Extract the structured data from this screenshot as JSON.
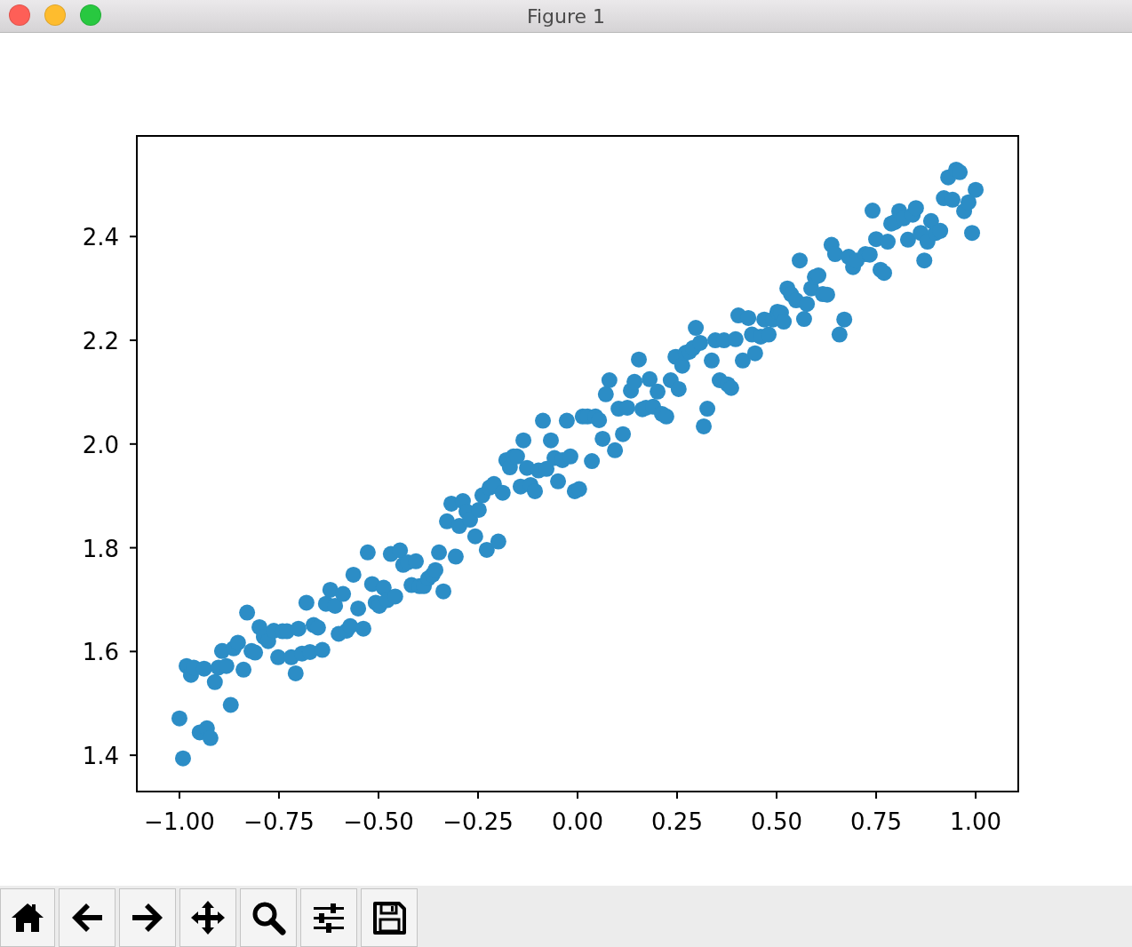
{
  "window": {
    "title": "Figure 1",
    "controls": [
      {
        "kind": "close"
      },
      {
        "kind": "minimize"
      },
      {
        "kind": "zoom"
      }
    ]
  },
  "chart_data": {
    "type": "scatter",
    "xlim": [
      -1.107,
      1.107
    ],
    "ylim": [
      1.33,
      2.594
    ],
    "xticks": [
      {
        "value": -1,
        "label": "−1.00"
      },
      {
        "value": -0.75,
        "label": "−0.75"
      },
      {
        "value": -0.5,
        "label": "−0.50"
      },
      {
        "value": -0.25,
        "label": "−0.25"
      },
      {
        "value": 0,
        "label": "0.00"
      },
      {
        "value": 0.25,
        "label": "0.25"
      },
      {
        "value": 0.5,
        "label": "0.50"
      },
      {
        "value": 0.75,
        "label": "0.75"
      },
      {
        "value": 1,
        "label": "1.00"
      }
    ],
    "yticks": [
      {
        "value": 1.4,
        "label": "1.4"
      },
      {
        "value": 1.6,
        "label": "1.6"
      },
      {
        "value": 1.8,
        "label": "1.8"
      },
      {
        "value": 2.0,
        "label": "2.0"
      },
      {
        "value": 2.2,
        "label": "2.2"
      },
      {
        "value": 2.4,
        "label": "2.4"
      }
    ],
    "x": [
      -1.0,
      -0.991,
      -0.982,
      -0.971,
      -0.964,
      -0.949,
      -0.938,
      -0.931,
      -0.922,
      -0.911,
      -0.902,
      -0.893,
      -0.882,
      -0.871,
      -0.864,
      -0.853,
      -0.839,
      -0.83,
      -0.819,
      -0.81,
      -0.799,
      -0.788,
      -0.777,
      -0.763,
      -0.752,
      -0.741,
      -0.73,
      -0.719,
      -0.708,
      -0.701,
      -0.692,
      -0.681,
      -0.672,
      -0.663,
      -0.652,
      -0.641,
      -0.632,
      -0.621,
      -0.609,
      -0.6,
      -0.589,
      -0.58,
      -0.571,
      -0.563,
      -0.551,
      -0.538,
      -0.527,
      -0.516,
      -0.507,
      -0.498,
      -0.487,
      -0.478,
      -0.469,
      -0.458,
      -0.446,
      -0.438,
      -0.426,
      -0.417,
      -0.406,
      -0.397,
      -0.386,
      -0.375,
      -0.364,
      -0.357,
      -0.348,
      -0.337,
      -0.328,
      -0.317,
      -0.306,
      -0.297,
      -0.288,
      -0.279,
      -0.27,
      -0.257,
      -0.248,
      -0.239,
      -0.228,
      -0.221,
      -0.21,
      -0.199,
      -0.188,
      -0.179,
      -0.17,
      -0.161,
      -0.152,
      -0.143,
      -0.136,
      -0.127,
      -0.118,
      -0.107,
      -0.098,
      -0.087,
      -0.078,
      -0.067,
      -0.058,
      -0.049,
      -0.038,
      -0.027,
      -0.018,
      -0.007,
      0.004,
      0.013,
      0.025,
      0.036,
      0.045,
      0.054,
      0.063,
      0.071,
      0.08,
      0.094,
      0.103,
      0.114,
      0.125,
      0.134,
      0.143,
      0.154,
      0.163,
      0.172,
      0.181,
      0.19,
      0.201,
      0.212,
      0.223,
      0.234,
      0.246,
      0.254,
      0.263,
      0.272,
      0.281,
      0.29,
      0.297,
      0.308,
      0.317,
      0.326,
      0.337,
      0.346,
      0.357,
      0.368,
      0.377,
      0.386,
      0.397,
      0.404,
      0.415,
      0.429,
      0.438,
      0.446,
      0.46,
      0.469,
      0.48,
      0.491,
      0.502,
      0.511,
      0.518,
      0.527,
      0.536,
      0.549,
      0.558,
      0.569,
      0.576,
      0.587,
      0.596,
      0.605,
      0.616,
      0.627,
      0.638,
      0.647,
      0.658,
      0.67,
      0.681,
      0.692,
      0.701,
      0.723,
      0.734,
      0.741,
      0.75,
      0.761,
      0.77,
      0.779,
      0.788,
      0.797,
      0.808,
      0.819,
      0.83,
      0.842,
      0.85,
      0.862,
      0.871,
      0.879,
      0.888,
      0.9,
      0.911,
      0.92,
      0.931,
      0.942,
      0.951,
      0.96,
      0.971,
      0.982,
      0.991,
      1.0
    ],
    "series": [
      {
        "color": "#2c8dc6",
        "values": [
          1.471,
          1.394,
          1.572,
          1.555,
          1.569,
          1.444,
          1.567,
          1.452,
          1.433,
          1.541,
          1.569,
          1.601,
          1.572,
          1.497,
          1.606,
          1.617,
          1.565,
          1.675,
          1.601,
          1.598,
          1.647,
          1.628,
          1.62,
          1.64,
          1.589,
          1.639,
          1.639,
          1.589,
          1.558,
          1.644,
          1.596,
          1.694,
          1.599,
          1.651,
          1.646,
          1.603,
          1.692,
          1.719,
          1.688,
          1.634,
          1.711,
          1.64,
          1.649,
          1.748,
          1.683,
          1.644,
          1.791,
          1.73,
          1.694,
          1.688,
          1.723,
          1.699,
          1.788,
          1.706,
          1.795,
          1.767,
          1.772,
          1.728,
          1.774,
          1.726,
          1.726,
          1.741,
          1.748,
          1.757,
          1.791,
          1.716,
          1.851,
          1.885,
          1.783,
          1.842,
          1.89,
          1.87,
          1.854,
          1.822,
          1.873,
          1.901,
          1.796,
          1.916,
          1.923,
          1.812,
          1.906,
          1.969,
          1.955,
          1.976,
          1.976,
          1.918,
          2.007,
          1.954,
          1.921,
          1.909,
          1.949,
          2.045,
          1.952,
          2.007,
          1.973,
          1.928,
          1.969,
          2.045,
          1.976,
          1.909,
          1.913,
          2.053,
          2.053,
          1.967,
          2.053,
          2.046,
          2.01,
          2.096,
          2.123,
          1.988,
          2.068,
          2.019,
          2.07,
          2.103,
          2.12,
          2.163,
          2.067,
          2.07,
          2.125,
          2.072,
          2.101,
          2.058,
          2.053,
          2.123,
          2.168,
          2.106,
          2.151,
          2.176,
          2.178,
          2.185,
          2.224,
          2.195,
          2.034,
          2.068,
          2.161,
          2.2,
          2.123,
          2.2,
          2.115,
          2.108,
          2.202,
          2.248,
          2.161,
          2.243,
          2.211,
          2.175,
          2.207,
          2.24,
          2.211,
          2.24,
          2.255,
          2.253,
          2.236,
          2.3,
          2.289,
          2.277,
          2.354,
          2.241,
          2.27,
          2.3,
          2.322,
          2.325,
          2.289,
          2.288,
          2.384,
          2.366,
          2.211,
          2.24,
          2.361,
          2.341,
          2.354,
          2.366,
          2.365,
          2.45,
          2.395,
          2.336,
          2.33,
          2.39,
          2.425,
          2.428,
          2.449,
          2.435,
          2.394,
          2.442,
          2.455,
          2.407,
          2.354,
          2.39,
          2.43,
          2.407,
          2.411,
          2.474,
          2.514,
          2.471,
          2.529,
          2.524,
          2.449,
          2.466,
          2.407,
          2.49
        ]
      }
    ]
  },
  "toolbar": [
    {
      "kind": "home"
    },
    {
      "kind": "back"
    },
    {
      "kind": "forward"
    },
    {
      "kind": "pan"
    },
    {
      "kind": "zoom"
    },
    {
      "kind": "configure"
    },
    {
      "kind": "save"
    }
  ]
}
